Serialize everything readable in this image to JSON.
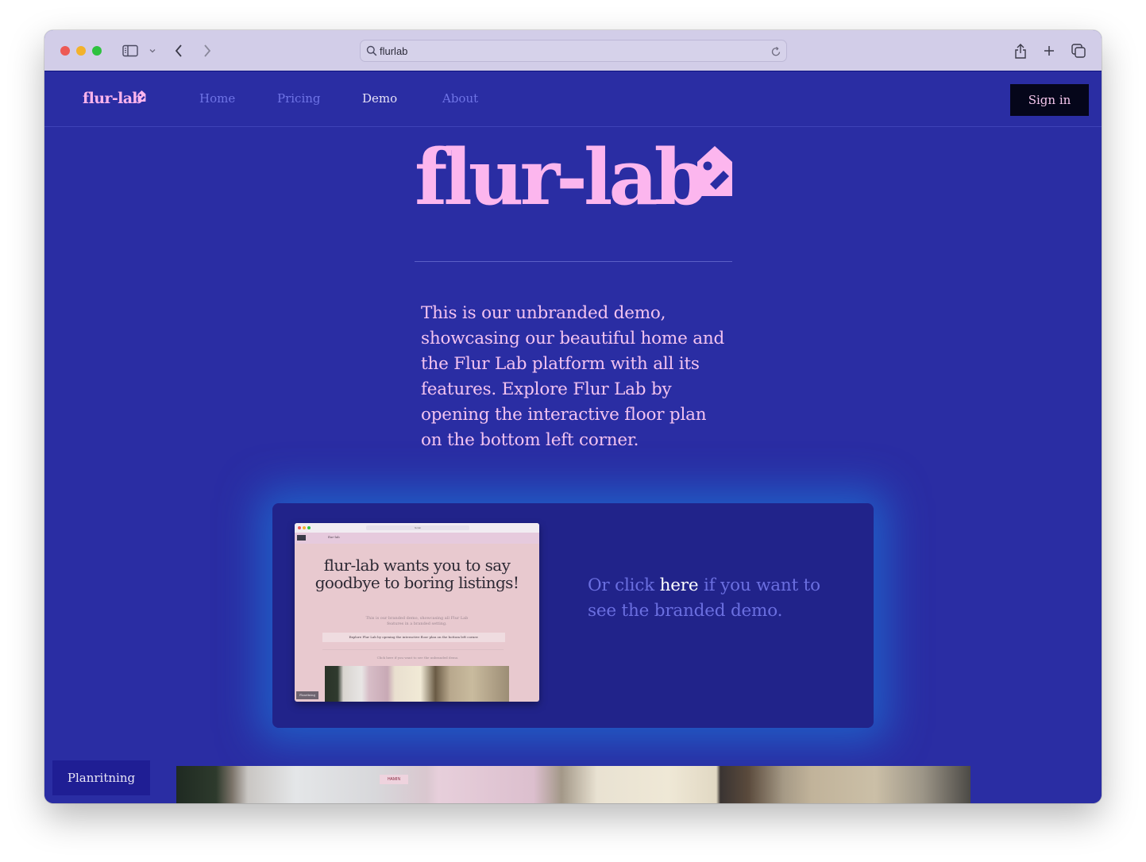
{
  "browser": {
    "url_text": "flurlab",
    "buttons": {
      "sidebar": "sidebar-toggle",
      "back": "back",
      "forward": "forward",
      "share": "share",
      "new_tab": "new-tab",
      "tabs_overview": "tab-overview"
    }
  },
  "nav": {
    "logo": "flur-lab",
    "links": [
      {
        "label": "Home",
        "active": false
      },
      {
        "label": "Pricing",
        "active": false
      },
      {
        "label": "Demo",
        "active": true
      },
      {
        "label": "About",
        "active": false
      }
    ],
    "sign_in": "Sign in"
  },
  "hero": {
    "title": "flur-lab",
    "intro": "This is our unbranded demo, showcasing our beautiful home and the Flur Lab platform with all its features. Explore Flur Lab by opening the interactive floor plan on the bottom left corner."
  },
  "card": {
    "preview": {
      "url": "flurlab",
      "nav_text": "flur-lab",
      "headline": "flur-lab wants you to say goodbye to boring listings!",
      "subtitle": "This is our branded demo, showcasing all Flur Lab features in a branded setting.",
      "explore": "Explore Flur Lab by opening the interactive floor plan on the bottom left corner.",
      "click_note": "Click here if you want to see the unbranded demo.",
      "plan_button": "Planritning"
    },
    "text_before": "Or click ",
    "link_text": "here",
    "text_after": " if you want to see the branded demo."
  },
  "floorplan_button": "Planritning",
  "photo_sign": "HAMIN",
  "colors": {
    "page_bg": "#2a2da3",
    "card_bg": "#21238a",
    "accent_pink": "#fcb6ee",
    "nav_link": "#6f74e6",
    "signin_bg": "#05061a",
    "titlebar": "#d2cde8"
  }
}
